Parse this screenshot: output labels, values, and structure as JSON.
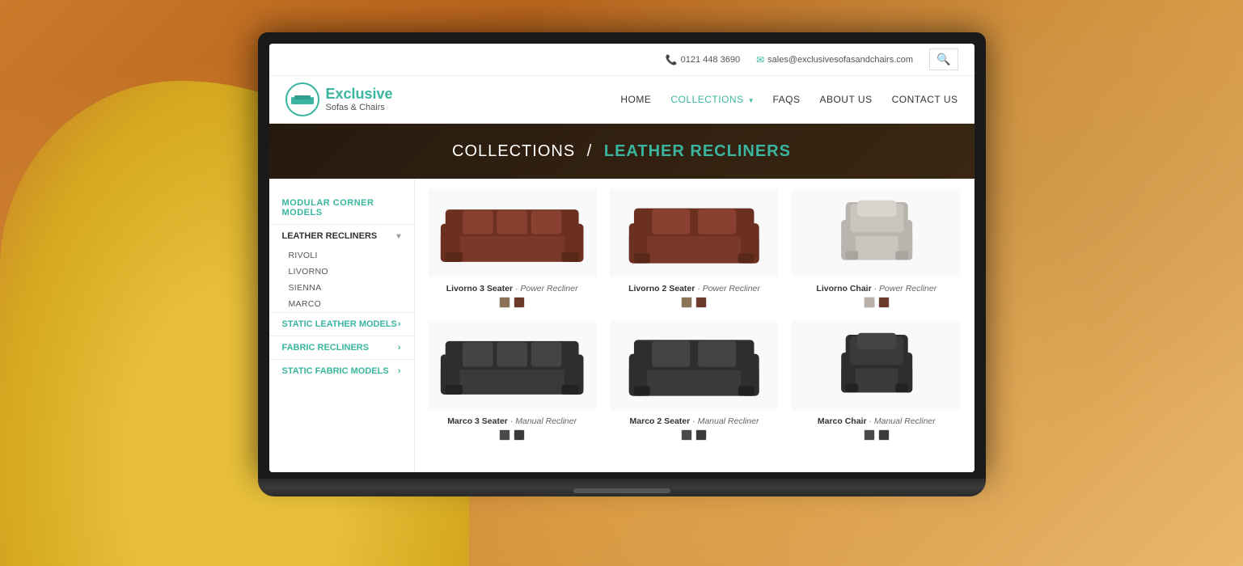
{
  "site": {
    "title": "Exclusive Sofas & Chairs",
    "logo": {
      "brand": "Exclusive",
      "subtitle": "Sofas & Chairs"
    },
    "header": {
      "phone_icon": "📞",
      "phone": "0121 448 3690",
      "email_icon": "✉",
      "email": "sales@exclusivesofasandchairs.com",
      "search_icon": "🔍"
    },
    "nav": [
      {
        "label": "HOME",
        "active": false
      },
      {
        "label": "COLLECTIONS",
        "active": true,
        "has_dropdown": true
      },
      {
        "label": "FAQS",
        "active": false
      },
      {
        "label": "ABOUT US",
        "active": false
      },
      {
        "label": "CONTACT US",
        "active": false
      }
    ]
  },
  "breadcrumb": {
    "parent": "COLLECTIONS",
    "separator": "/",
    "current": "LEATHER RECLINERS"
  },
  "sidebar": {
    "categories": [
      {
        "label": "MODULAR CORNER MODELS",
        "type": "link",
        "color": "teal"
      },
      {
        "label": "LEATHER RECLINERS",
        "type": "expandable",
        "expanded": true,
        "items": [
          "RIVOLI",
          "LIVORNO",
          "SIENNA",
          "MARCO"
        ]
      },
      {
        "label": "STATIC LEATHER MODELS",
        "type": "nav-link"
      },
      {
        "label": "FABRIC RECLINERS",
        "type": "nav-link"
      },
      {
        "label": "STATIC FABRIC MODELS",
        "type": "nav-link"
      }
    ]
  },
  "products": {
    "rows": [
      [
        {
          "name": "Livorno 3 Seater",
          "type": "Power Recliner",
          "colors": [
            "#8b7355",
            "#6b3a2a"
          ]
        },
        {
          "name": "Livorno 2 Seater",
          "type": "Power Recliner",
          "colors": [
            "#8b7355",
            "#6b3a2a"
          ]
        },
        {
          "name": "Livorno Chair",
          "type": "Power Recliner",
          "colors": [
            "#b8b0a8",
            "#6b3a2a"
          ]
        }
      ],
      [
        {
          "name": "Marco 3 Seater",
          "type": "Manual Recliner",
          "colors": [
            "#4a4a4a",
            "#3a3a3a"
          ]
        },
        {
          "name": "Marco 2 Seater",
          "type": "Manual Recliner",
          "colors": [
            "#4a4a4a",
            "#3a3a3a"
          ]
        },
        {
          "name": "Marco Chair",
          "type": "Manual Recliner",
          "colors": [
            "#4a4a4a",
            "#3a3a3a"
          ]
        }
      ]
    ]
  }
}
